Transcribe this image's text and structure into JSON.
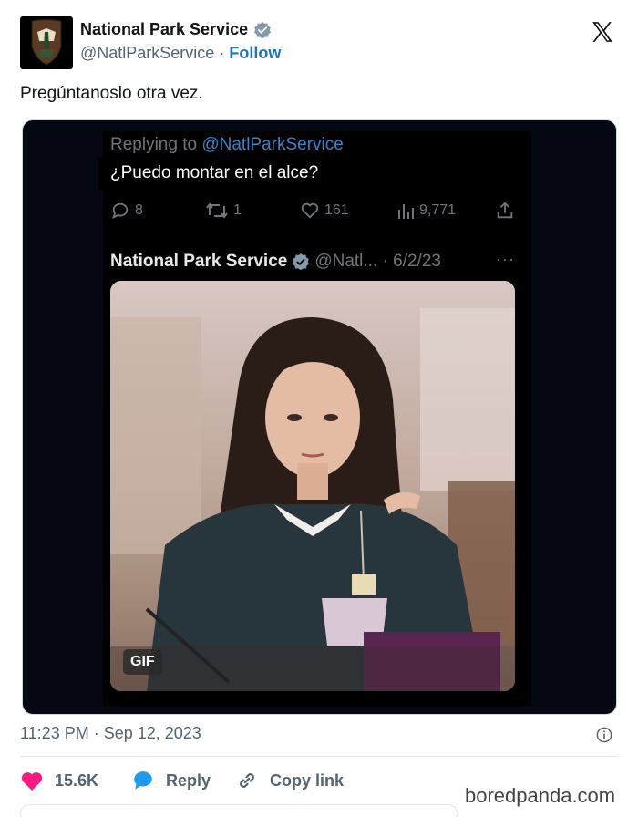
{
  "account": {
    "name": "National Park Service",
    "handle": "@NatlParkService",
    "separator": "·",
    "follow_label": "Follow"
  },
  "tweet": {
    "text": "Pregúntanoslo otra vez.",
    "timestamp": "11:23 PM · Sep 12, 2023"
  },
  "media": {
    "replying_prefix": "Replying to",
    "replying_mention": "@NatlParkService",
    "caption": "¿Puedo montar en el alce?",
    "replies": "8",
    "retweets": "1",
    "likes": "161",
    "views": "9,771",
    "quoted": {
      "name": "National Park Service",
      "handle_date": "@Natl... · 6/2/23",
      "more": "···"
    },
    "gif_label": "GIF"
  },
  "footer": {
    "likes_count": "15.6K",
    "reply_label": "Reply",
    "copy_link_label": "Copy link"
  },
  "watermark": "boredpanda.com",
  "colors": {
    "verified": "#829aab",
    "follow": "#1d73c6",
    "heart": "#f91880",
    "reply_bubble": "#1d9bf0",
    "mention": "#3b82c4"
  }
}
